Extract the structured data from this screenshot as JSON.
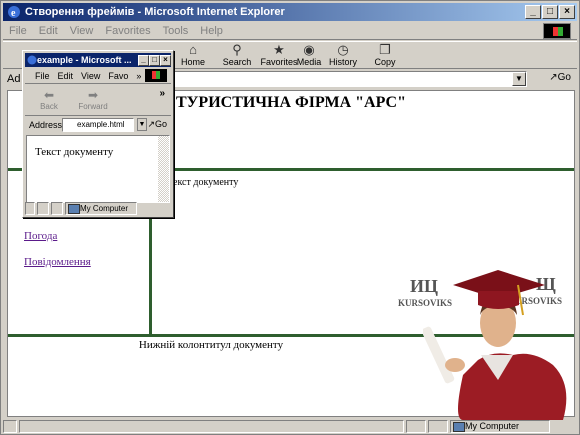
{
  "window": {
    "title": "Створення фреймів - Microsoft Internet Explorer",
    "controls": [
      "_",
      "□",
      "×"
    ]
  },
  "menubar": [
    "File",
    "Edit",
    "View",
    "Favorites",
    "Tools",
    "Help"
  ],
  "toolbar": {
    "back_partial": "",
    "buttons": [
      {
        "label": "Home",
        "icon": "home-icon"
      },
      {
        "label": "Search",
        "icon": "search-icon"
      },
      {
        "label": "Favorites",
        "icon": "favorites-icon"
      },
      {
        "label": "Media",
        "icon": "media-icon"
      },
      {
        "label": "History",
        "icon": "history-icon"
      },
      {
        "label": "Copy",
        "icon": "copy-icon"
      }
    ]
  },
  "address": {
    "label_partial": "Ad",
    "go_label": "Go"
  },
  "page": {
    "title": "ТУРИСТИЧНА ФІРМА \"АРС\"",
    "nav_links": [
      "Погода",
      "Повідомлення"
    ],
    "main_text": "екст документу",
    "footer_text": "Нижній колонтитул документу"
  },
  "watermark": {
    "logo_left": "ИЦ",
    "brand_left": "KURSOVIKS",
    "logo_right": "Щ",
    "brand_right": "KURSOVIKS"
  },
  "status": {
    "zone": "My Computer"
  },
  "popup": {
    "title": "example - Microsoft ...",
    "menu": [
      "File",
      "Edit",
      "View",
      "Favo"
    ],
    "menu_more": "»",
    "toolbar": [
      {
        "label": "Back"
      },
      {
        "label": "Forward"
      }
    ],
    "toolbar_more": "»",
    "address_label": "Address",
    "address_value": "example.html",
    "go_label": "Go",
    "content_text": "Текст документу",
    "status_zone": "My Computer"
  }
}
